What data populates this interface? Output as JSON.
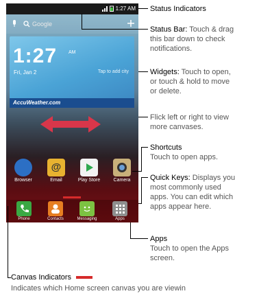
{
  "phone": {
    "status_time": "1:27 AM",
    "search_label": "Google",
    "clock_time": "1:27",
    "clock_ampm": "AM",
    "clock_date": "Fri, Jan 2",
    "tap_to_add": "Tap to add city",
    "weather_brand": "AccuWeather.com",
    "shortcuts": [
      {
        "label": "Browser",
        "color": "#2c6fc4"
      },
      {
        "label": "Email",
        "color": "#e8b230"
      },
      {
        "label": "Play Store",
        "color": "#f2f2f2"
      },
      {
        "label": "Camera",
        "color": "#c8b07a"
      }
    ],
    "dock": [
      {
        "label": "Phone",
        "color": "#3aa843"
      },
      {
        "label": "Contacts",
        "color": "#e67e22"
      },
      {
        "label": "Messaging",
        "color": "#7cc242"
      },
      {
        "label": "Apps",
        "color": "#8e8e8e"
      }
    ]
  },
  "annotations": {
    "status_indicators": "Status Indicators",
    "status_bar_title": "Status Bar:",
    "status_bar_desc_1": " Touch & drag",
    "status_bar_desc_2": "this bar down to check",
    "status_bar_desc_3": "notifications.",
    "widgets_title": "Widgets:",
    "widgets_desc_1": " Touch to open,",
    "widgets_desc_2": "or touch & hold to move",
    "widgets_desc_3": "or delete.",
    "flick_1": "Flick left or right to view",
    "flick_2": "more canvases.",
    "shortcuts_title": "Shortcuts",
    "shortcuts_desc": "Touch to open apps.",
    "quickkeys_title": "Quick Keys:",
    "quickkeys_desc_1": " Displays you",
    "quickkeys_desc_2": "most commonly used",
    "quickkeys_desc_3": "apps. You can edit which",
    "quickkeys_desc_4": "apps appear here.",
    "apps_title": "Apps",
    "apps_desc_1": "Touch to open the Apps",
    "apps_desc_2": "screen.",
    "canvas_title": "Canvas Indicators",
    "canvas_desc": "Indicates which Home screen canvas you are viewin"
  }
}
